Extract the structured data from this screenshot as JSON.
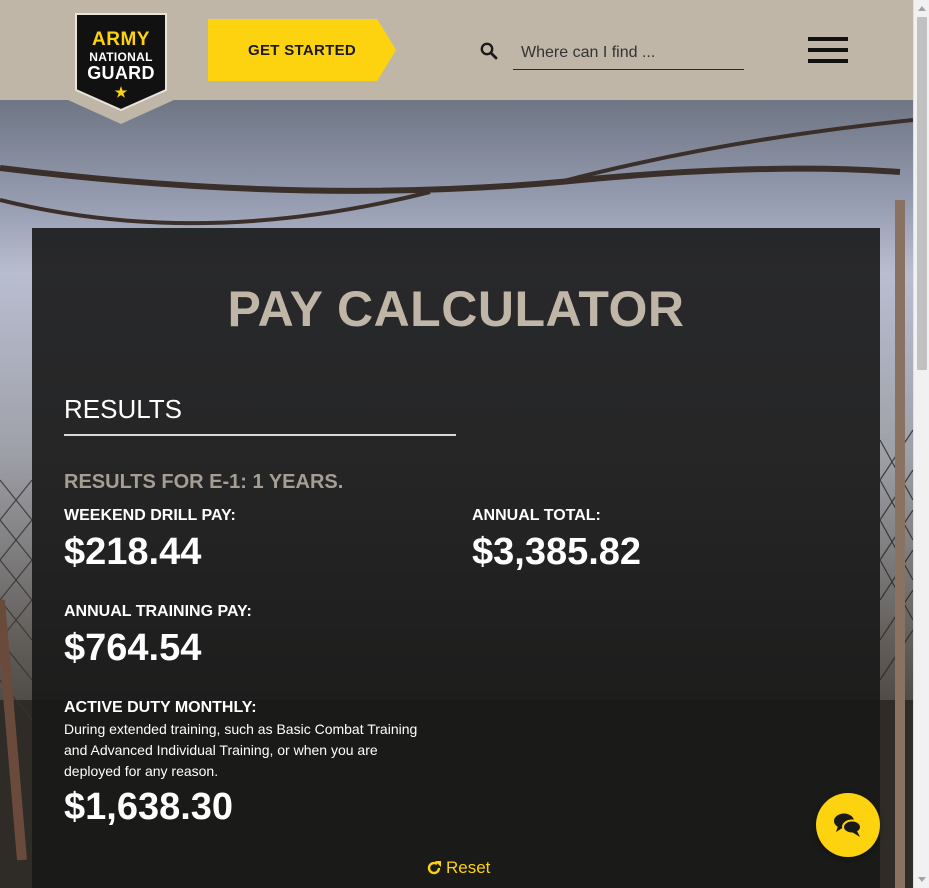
{
  "header": {
    "logo": {
      "line1": "ARMY",
      "line2": "NATIONAL",
      "line3": "GUARD",
      "star": "★"
    },
    "cta_label": "GET STARTED",
    "search": {
      "placeholder": "Where can I find ...",
      "icon": "search-icon"
    },
    "menu_icon": "hamburger-menu-icon"
  },
  "calculator": {
    "title": "PAY CALCULATOR",
    "results_heading": "RESULTS",
    "results_for": "RESULTS FOR E-1: 1 YEARS.",
    "weekend_drill": {
      "label": "WEEKEND DRILL PAY:",
      "amount": "$218.44"
    },
    "annual_total": {
      "label": "ANNUAL TOTAL:",
      "amount": "$3,385.82"
    },
    "annual_training": {
      "label": "ANNUAL TRAINING PAY:",
      "amount": "$764.54"
    },
    "active_duty": {
      "label": "ACTIVE DUTY MONTHLY:",
      "description": "During extended training, such as Basic Combat Training and Advanced Individual Training, or when you are deployed for any reason.",
      "amount": "$1,638.30"
    },
    "reset_label": "Reset"
  },
  "chat": {
    "icon": "chat-bubbles-icon"
  },
  "colors": {
    "brand_yellow": "#fdd20e",
    "header_tan": "#bfb6a8",
    "panel_dark": "#181818",
    "subtitle_tan": "#a59e93"
  }
}
